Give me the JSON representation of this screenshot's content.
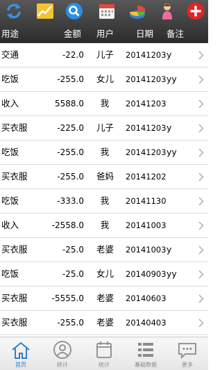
{
  "toolbar": {
    "icons": [
      "refresh-icon",
      "chart-icon",
      "search-icon",
      "calendar-icon",
      "pie-chart-icon",
      "user-icon",
      "add-icon"
    ]
  },
  "header": {
    "use": "用途",
    "amount": "金额",
    "user": "用户",
    "date": "日期",
    "note": "备注"
  },
  "rows": [
    {
      "use": "交通",
      "amount": "-22.0",
      "user": "儿子",
      "date": "20141203",
      "note": "y"
    },
    {
      "use": "吃饭",
      "amount": "-255.0",
      "user": "女儿",
      "date": "20141203",
      "note": "yy"
    },
    {
      "use": "收入",
      "amount": "5588.0",
      "user": "我",
      "date": "20141203",
      "note": ""
    },
    {
      "use": "买衣服",
      "amount": "-225.0",
      "user": "儿子",
      "date": "20141203",
      "note": "y"
    },
    {
      "use": "吃饭",
      "amount": "-255.0",
      "user": "我",
      "date": "20141203",
      "note": "yy"
    },
    {
      "use": "买衣服",
      "amount": "-255.0",
      "user": "爸妈",
      "date": "20141202",
      "note": ""
    },
    {
      "use": "吃饭",
      "amount": "-333.0",
      "user": "我",
      "date": "20141130",
      "note": ""
    },
    {
      "use": "收入",
      "amount": "-2558.0",
      "user": "我",
      "date": "20141003",
      "note": ""
    },
    {
      "use": "买衣服",
      "amount": "-25.0",
      "user": "老婆",
      "date": "20141003",
      "note": "y"
    },
    {
      "use": "吃饭",
      "amount": "-25.0",
      "user": "女儿",
      "date": "20140903",
      "note": "yy"
    },
    {
      "use": "买衣服",
      "amount": "-5555.0",
      "user": "老婆",
      "date": "20140603",
      "note": ""
    },
    {
      "use": "买衣服",
      "amount": "-255.0",
      "user": "老婆",
      "date": "20140403",
      "note": ""
    }
  ],
  "tabbar": {
    "tabs": [
      {
        "label": "首页",
        "icon": "home-icon",
        "active": true
      },
      {
        "label": "统计",
        "icon": "person-icon",
        "active": false
      },
      {
        "label": "统计",
        "icon": "calendar-icon",
        "active": false
      },
      {
        "label": "基础数据",
        "icon": "list-icon",
        "active": false
      },
      {
        "label": "更多",
        "icon": "chat-icon",
        "active": false
      }
    ]
  },
  "colors": {
    "header_bg": "#3a3a3a",
    "active_tab": "#2d7dd2",
    "add_button": "#e02424"
  }
}
